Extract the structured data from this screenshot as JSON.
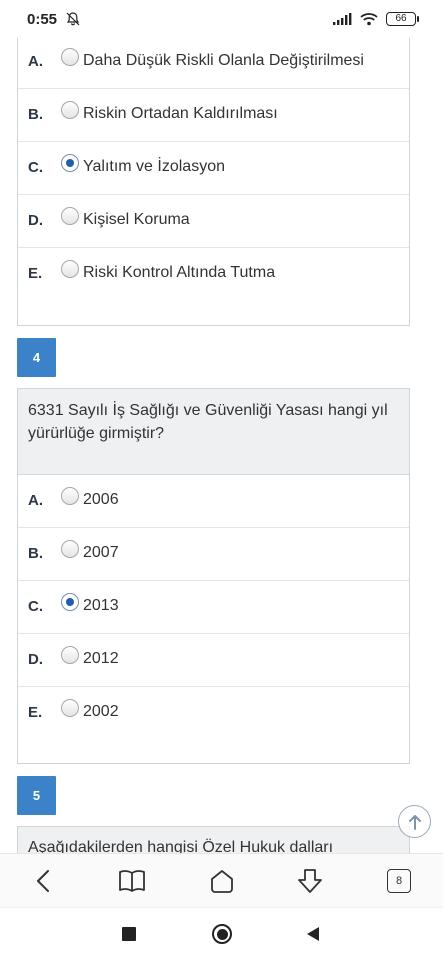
{
  "status": {
    "time": "0:55",
    "battery": "66"
  },
  "question3": {
    "options": [
      {
        "letter": "A.",
        "text": "Daha Düşük Riskli Olanla Değiştirilmesi",
        "checked": false
      },
      {
        "letter": "B.",
        "text": "Riskin Ortadan Kaldırılması",
        "checked": false
      },
      {
        "letter": "C.",
        "text": "Yalıtım ve İzolasyon",
        "checked": true
      },
      {
        "letter": "D.",
        "text": "Kişisel Koruma",
        "checked": false
      },
      {
        "letter": "E.",
        "text": "Riski Kontrol Altında Tutma",
        "checked": false
      }
    ]
  },
  "question4": {
    "number": "4",
    "text": "6331 Sayılı İş Sağlığı ve Güvenliği Yasası hangi yıl yürürlüğe girmiştir?",
    "options": [
      {
        "letter": "A.",
        "text": "2006",
        "checked": false
      },
      {
        "letter": "B.",
        "text": "2007",
        "checked": false
      },
      {
        "letter": "C.",
        "text": "2013",
        "checked": true
      },
      {
        "letter": "D.",
        "text": "2012",
        "checked": false
      },
      {
        "letter": "E.",
        "text": "2002",
        "checked": false
      }
    ]
  },
  "question5": {
    "number": "5",
    "text": "Aşağıdakilerden hangisi Özel Hukuk dalları arasında"
  },
  "browser": {
    "tab_count": "8"
  },
  "icons": {
    "back": "chevron-left-icon",
    "bookmarks": "book-icon",
    "home": "home-icon",
    "download": "download-icon",
    "tabs": "tabs-icon",
    "scroll_top": "arrow-up-circle-icon"
  },
  "colors": {
    "accent": "#3b82c8",
    "radio_checked": "#1f5ea8",
    "question_bg": "#eef0f2"
  }
}
